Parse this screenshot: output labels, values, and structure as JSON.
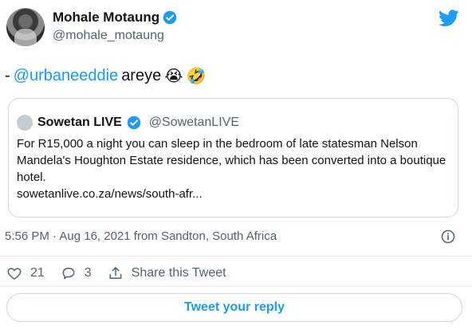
{
  "author": {
    "name": "Mohale Motaung",
    "handle": "@mohale_motaung"
  },
  "tweet": {
    "prefix": "-",
    "mention": "@urbaneeddie",
    "text": "areye",
    "emojis": [
      "😭",
      "🤣"
    ]
  },
  "quote": {
    "name": "Sowetan LIVE",
    "handle": "@SowetanLIVE",
    "text": "For R15,000 a night you can sleep in the bedroom of  late statesman Nelson Mandela's Houghton Estate residence, which has been converted into a boutique hotel.",
    "link": "sowetanlive.co.za/news/south-afr..."
  },
  "meta": {
    "timestamp": "5:56 PM · Aug 16, 2021 from Sandton, South Africa"
  },
  "actions": {
    "likes": "21",
    "replies": "3",
    "share_label": "Share this Tweet"
  },
  "reply_button": {
    "label": "Tweet your reply"
  },
  "colors": {
    "accent": "#1d9bf0",
    "text": "#0f1419",
    "muted": "#536471",
    "border": "#cfd9de"
  },
  "icons": [
    "verified-icon",
    "twitter-logo-icon",
    "info-icon",
    "heart-icon",
    "reply-icon",
    "share-icon"
  ]
}
